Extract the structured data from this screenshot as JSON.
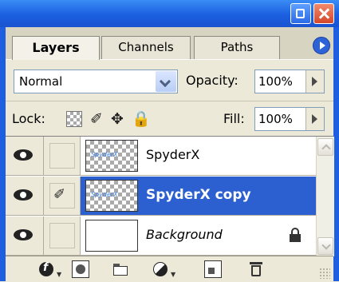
{
  "tabs": [
    {
      "label": "Layers",
      "active": true
    },
    {
      "label": "Channels",
      "active": false
    },
    {
      "label": "Paths",
      "active": false
    }
  ],
  "blend_mode": {
    "value": "Normal"
  },
  "opacity": {
    "label": "Opacity:",
    "value": "100%"
  },
  "lock": {
    "label": "Lock:",
    "icons": [
      "lock-transparency-icon",
      "lock-paint-brush-icon",
      "lock-move-icon",
      "lock-all-icon"
    ]
  },
  "fill": {
    "label": "Fill:",
    "value": "100%"
  },
  "layers": [
    {
      "name": "SpyderX",
      "visible": true,
      "thumb_text": "SpyderX",
      "selected": false,
      "linked_brush": false,
      "locked": false
    },
    {
      "name": "SpyderX copy",
      "visible": true,
      "thumb_text": "SpyderX",
      "selected": true,
      "linked_brush": true,
      "locked": false
    },
    {
      "name": "Background",
      "visible": true,
      "thumb_text": "",
      "selected": false,
      "linked_brush": false,
      "locked": true
    }
  ],
  "footer_icons": [
    "layer-styles-icon",
    "layer-mask-icon",
    "layer-set-folder-icon",
    "adjustment-layer-icon",
    "new-layer-icon",
    "trash-icon"
  ],
  "colors": {
    "title_bar": "#1b5fe0",
    "selection": "#2c5fd0",
    "panel": "#ece9d8"
  }
}
